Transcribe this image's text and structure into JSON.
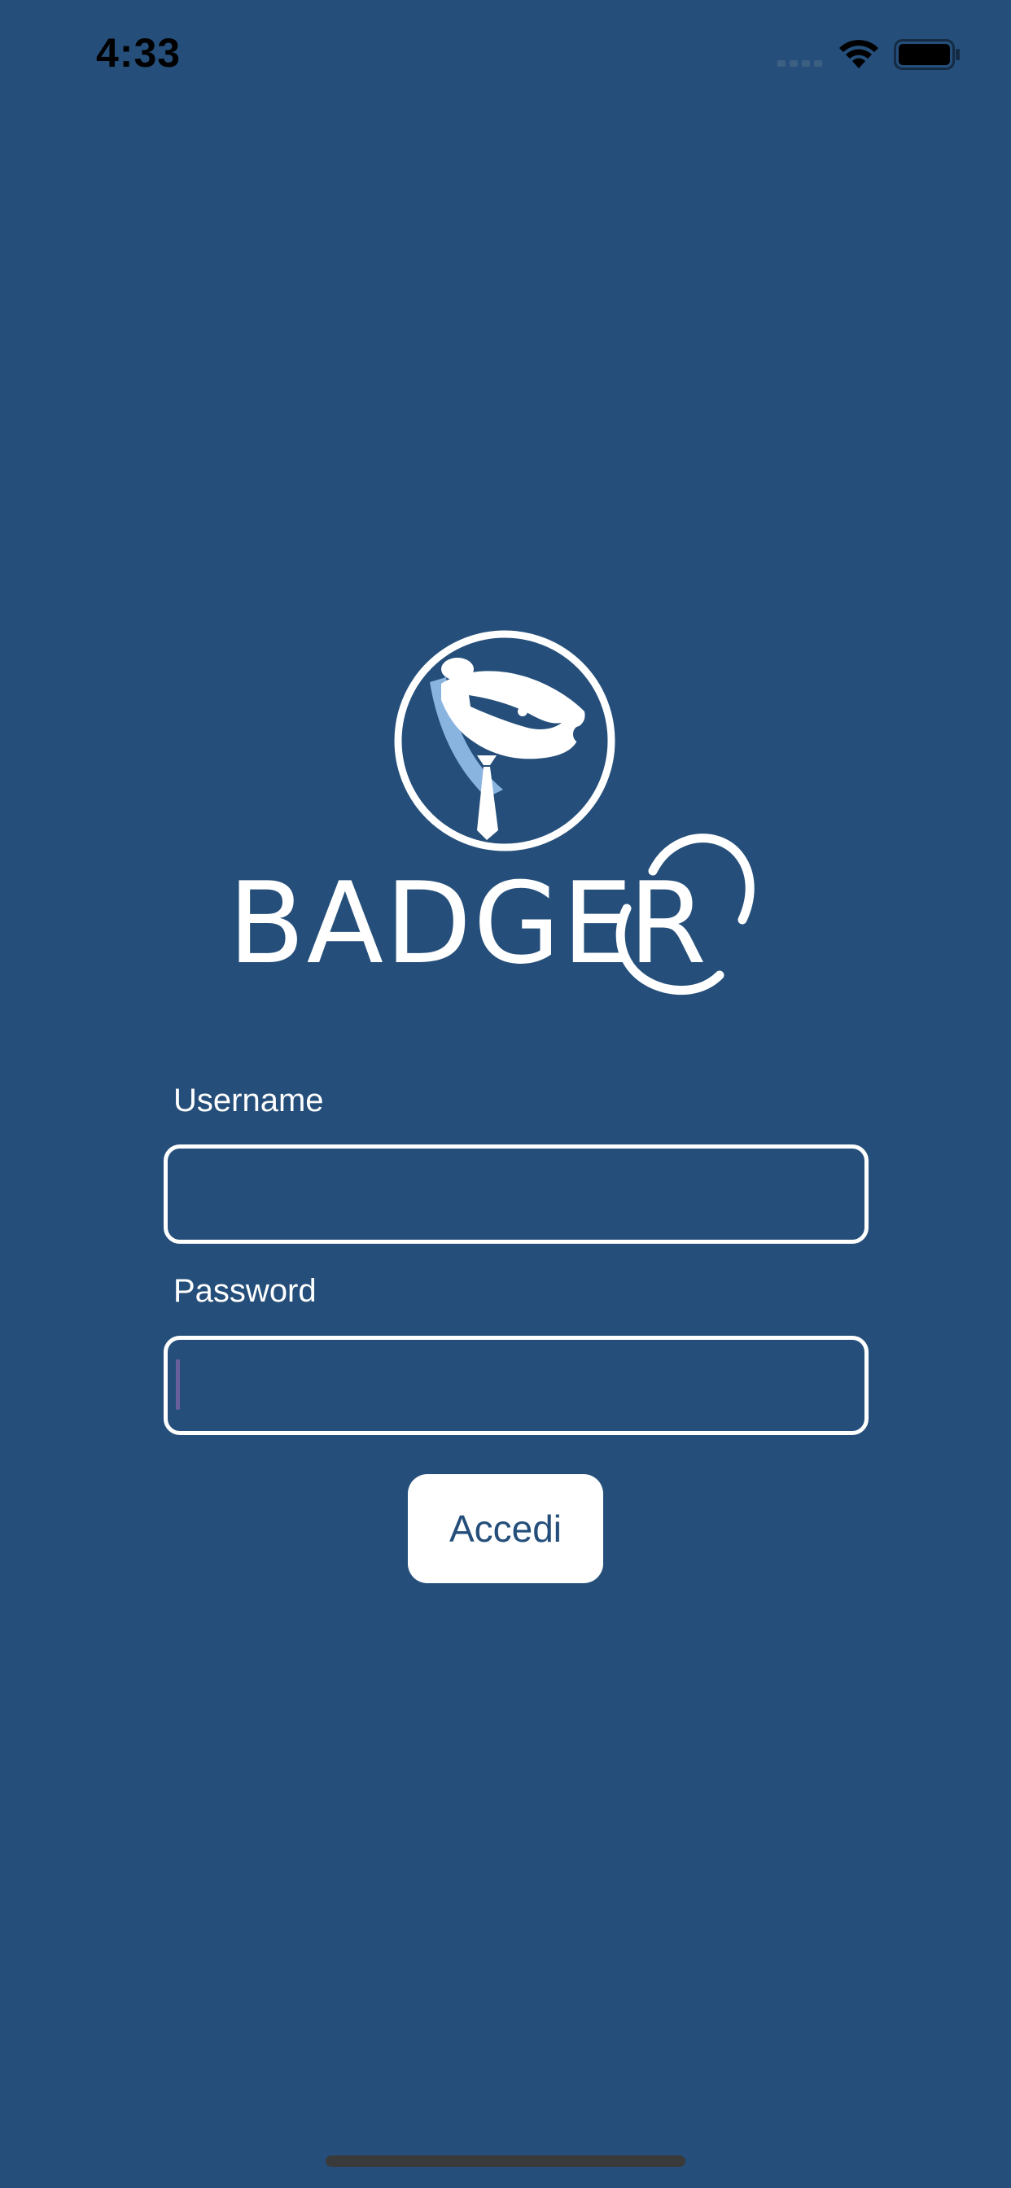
{
  "status_bar": {
    "time": "4:33",
    "icons": [
      "signal-icon",
      "wifi-icon",
      "battery-icon"
    ]
  },
  "logo": {
    "name": "badger-logo",
    "wordmark": "BADGER"
  },
  "form": {
    "username_label": "Username",
    "username_value": "",
    "password_label": "Password",
    "password_value": "",
    "submit_label": "Accedi"
  },
  "colors": {
    "background": "#254f7a",
    "foreground": "#ffffff",
    "logo_accent": "#8ab4e0"
  }
}
